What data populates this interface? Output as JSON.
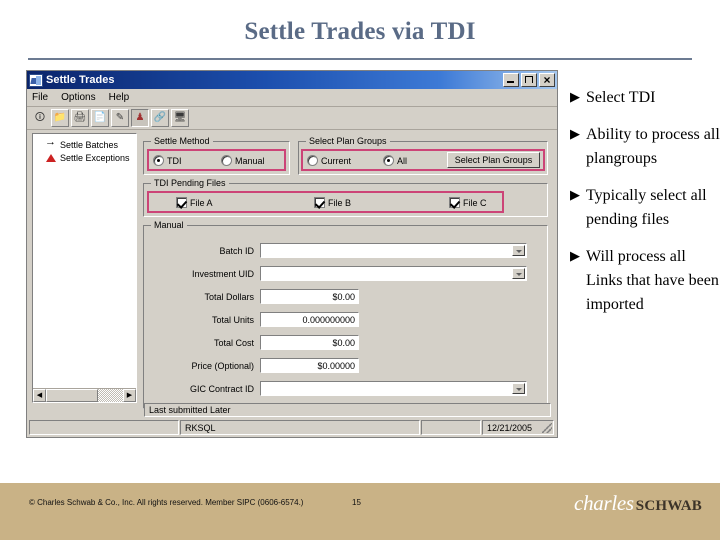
{
  "slide": {
    "title": "Settle Trades via TDI",
    "bullets": [
      {
        "marker": "▶",
        "text": "Select TDI"
      },
      {
        "marker": "▶",
        "text": "Ability to process all plangroups"
      },
      {
        "marker": "▶",
        "text": "Typically select all pending files"
      },
      {
        "marker": "▶",
        "text": "Will process all Links that have been imported"
      }
    ]
  },
  "app_window": {
    "title": "Settle Trades",
    "window_buttons": {
      "minimize": "minimize-button",
      "maximize": "maximize-button",
      "close": "close-button"
    },
    "menu": [
      "File",
      "Options",
      "Help"
    ],
    "toolbar_icons": [
      "help-pointer-icon",
      "open-folder-icon",
      "print-icon",
      "document-icon",
      "edit-pencil-icon",
      "person-icon",
      "link-icon",
      "screen-icon"
    ],
    "tree": {
      "items": [
        {
          "icon": "arrow-icon",
          "label": "Settle Batches"
        },
        {
          "icon": "warning-triangle-icon",
          "label": "Settle Exceptions"
        }
      ]
    },
    "settle_method": {
      "legend": "Settle Method",
      "options": [
        {
          "label": "TDI",
          "selected": true
        },
        {
          "label": "Manual",
          "selected": false
        }
      ]
    },
    "select_plan_groups": {
      "legend": "Select Plan Groups",
      "options": [
        {
          "label": "Current",
          "selected": false
        },
        {
          "label": "All",
          "selected": true
        }
      ],
      "button_label": "Select Plan Groups"
    },
    "tdi_pending_files": {
      "legend": "TDI Pending Files",
      "checkboxes": [
        {
          "label": "File A",
          "checked": true
        },
        {
          "label": "File B",
          "checked": true
        },
        {
          "label": "File C",
          "checked": true
        }
      ]
    },
    "manual": {
      "legend": "Manual",
      "fields": [
        {
          "label": "Batch ID",
          "value": "",
          "type": "combo"
        },
        {
          "label": "Investment UID",
          "value": "",
          "type": "combo"
        },
        {
          "label": "Total Dollars",
          "value": "$0.00",
          "type": "text"
        },
        {
          "label": "Total Units",
          "value": "0.000000000",
          "type": "text"
        },
        {
          "label": "Total Cost",
          "value": "$0.00",
          "type": "text"
        },
        {
          "label": "Price (Optional)",
          "value": "$0.00000",
          "type": "text"
        },
        {
          "label": "GIC Contract ID",
          "value": "",
          "type": "combo"
        }
      ]
    },
    "bottom_label": "Last submitted Later",
    "statusbar": {
      "cell1": "",
      "cell2": "RKSQL",
      "cell3": "",
      "date": "12/21/2005"
    }
  },
  "footer": {
    "copyright": "© Charles Schwab & Co., Inc.  All rights reserved.  Member SIPC  (0606-6574.)",
    "page_number": "15",
    "logo_primary": "charles",
    "logo_secondary": "SCHWAB"
  }
}
